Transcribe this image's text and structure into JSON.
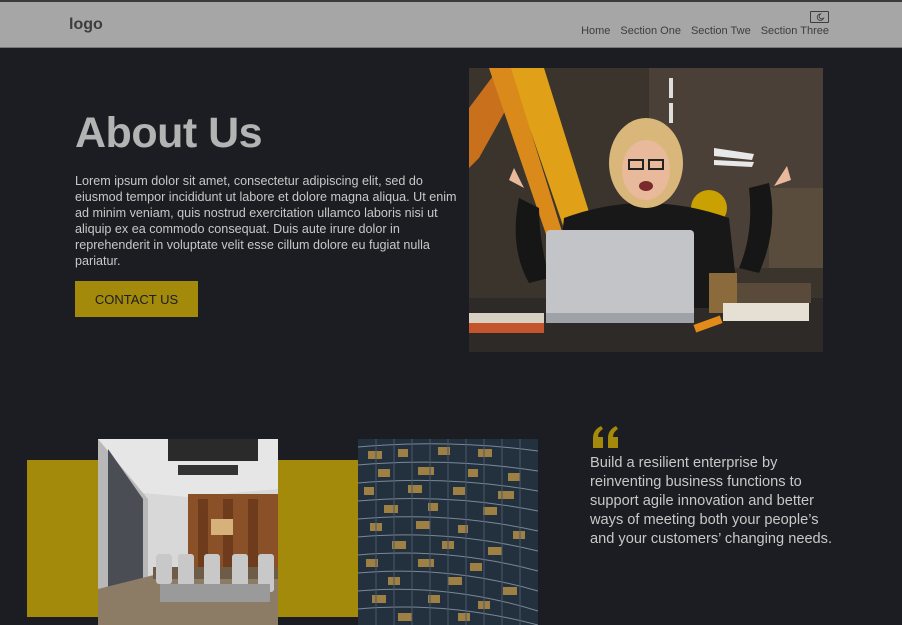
{
  "header": {
    "logo": "logo",
    "theme_toggle_icon": "moon-icon",
    "nav": [
      "Home",
      "Section One",
      "Section Twe",
      "Section Three"
    ]
  },
  "hero": {
    "title": "About Us",
    "body": "Lorem ipsum dolor sit amet, consectetur adipiscing elit, sed do eiusmod tempor incididunt ut labore et dolore magna aliqua. Ut enim ad minim veniam, quis nostrud exercitation ullamco laboris nisi ut aliquip ex ea commodo consequat. Duis aute irure dolor in reprehenderit in voluptate velit esse cillum dolore eu fugiat nulla pariatur.",
    "cta_label": "CONTACT US"
  },
  "quote": {
    "icon": "quote-icon",
    "text": "Build a resilient enterprise by reinventing business functions to support agile innovation and better ways of meeting both your people’s and your customers’ changing needs."
  },
  "colors": {
    "background": "#1b1d22",
    "header": "#a6a6a6",
    "accent": "#a38a0b",
    "text": "#c8c8c8"
  }
}
